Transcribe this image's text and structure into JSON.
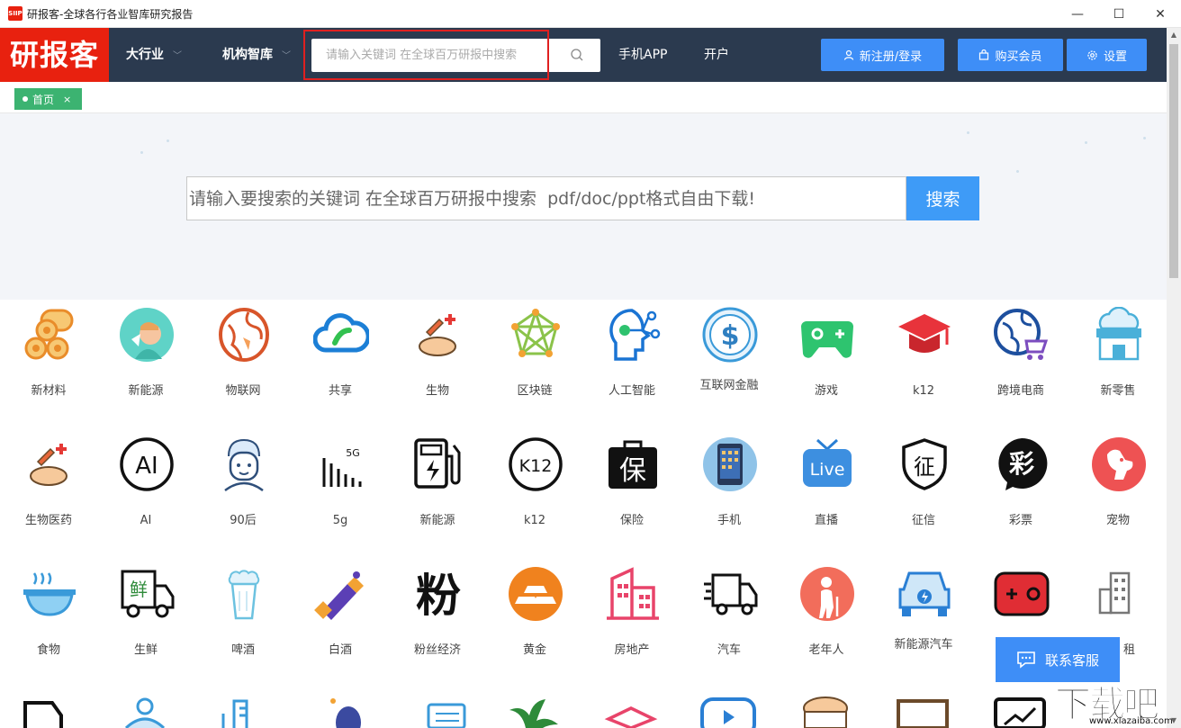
{
  "window": {
    "title": "研报客-全球各行各业智库研究报告",
    "app_icon_text": "SIIP",
    "controls": [
      "—",
      "☐",
      "✕"
    ]
  },
  "header": {
    "logo": "研报客",
    "nav": [
      {
        "label": "大行业",
        "dropdown": true
      },
      {
        "label": "机构智库",
        "dropdown": true
      }
    ],
    "search_placeholder": "请输入关键词 在全球百万研报中搜索",
    "links": [
      "手机APP",
      "开户"
    ],
    "buttons": {
      "register": "新注册/登录",
      "vip": "购买会员",
      "settings": "设置"
    }
  },
  "tabs": [
    {
      "label": "首页",
      "close": "×"
    }
  ],
  "hero": {
    "search_placeholder": "请输入要搜索的关键词 在全球百万研报中搜索  pdf/doc/ppt格式自由下载!",
    "search_button": "搜索"
  },
  "categories": [
    [
      "新材料",
      "新能源",
      "物联网",
      "共享",
      "生物",
      "区块链",
      "人工智能",
      "互联网金融",
      "游戏",
      "k12",
      "跨境电商",
      "新零售"
    ],
    [
      "生物医药",
      "AI",
      "90后",
      "5g",
      "新能源",
      "k12",
      "保险",
      "手机",
      "直播",
      "征信",
      "彩票",
      "宠物"
    ],
    [
      "食物",
      "生鲜",
      "啤酒",
      "白酒",
      "粉丝经济",
      "黄金",
      "房地产",
      "汽车",
      "老年人",
      "新能源汽车",
      "",
      "租"
    ]
  ],
  "icon_glyphs": {
    "ai": "AI",
    "k12": "K12",
    "insurance": "保",
    "live": "Live",
    "credit": "征",
    "lottery": "彩",
    "fresh": "鲜",
    "fans": "粉",
    "fiveg": "5G"
  },
  "service_button": "联系客服",
  "watermark": {
    "big": "下载吧",
    "small": "www.xiazaiba.com"
  },
  "colors": {
    "brand_red": "#e8210f",
    "nav_bg": "#2b3a4f",
    "primary_blue": "#3e8ef7",
    "tab_green": "#3cb371"
  }
}
